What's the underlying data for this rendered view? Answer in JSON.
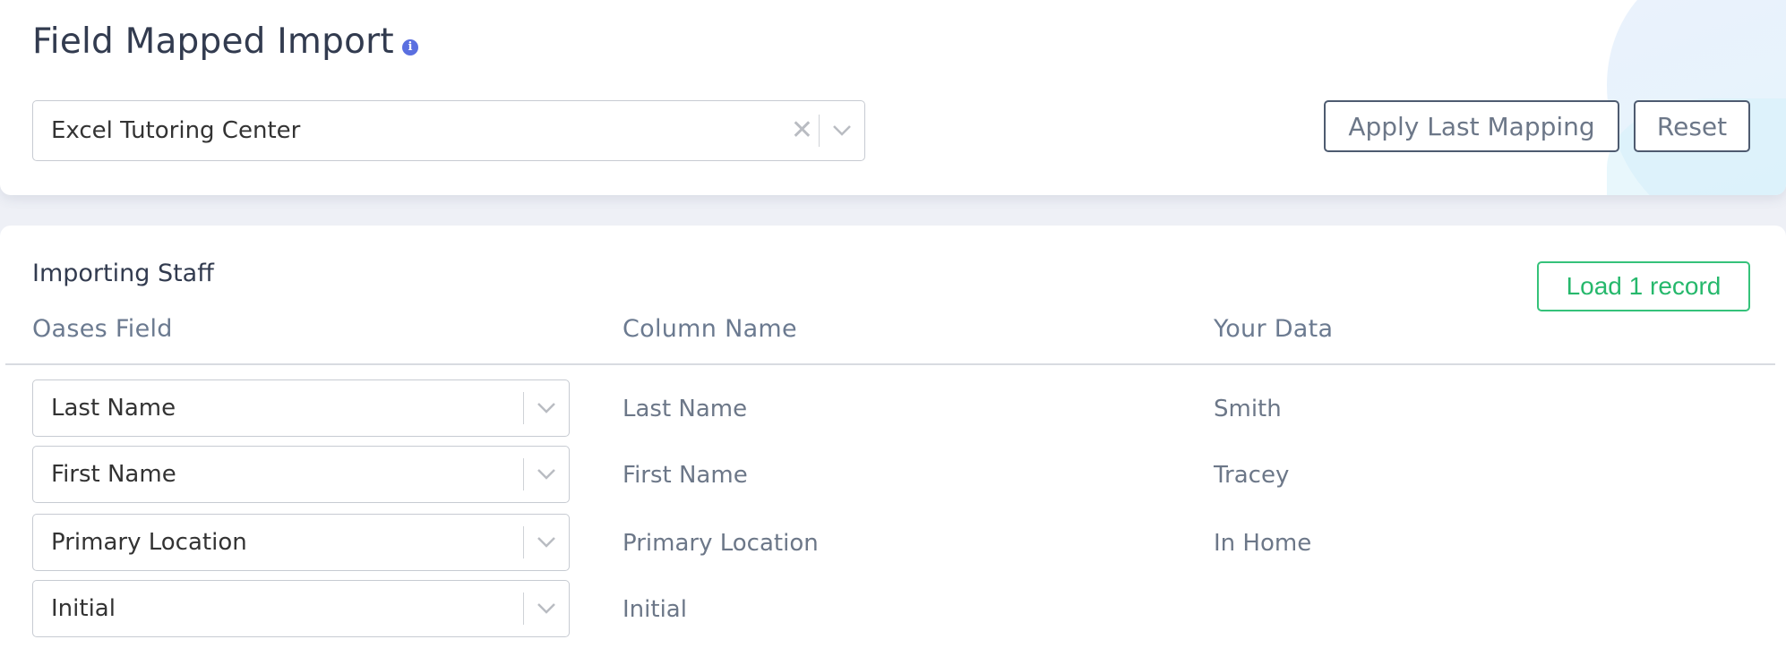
{
  "header": {
    "title": "Field Mapped Import",
    "info_icon": "info-icon",
    "company_select": {
      "value": "Excel Tutoring Center"
    },
    "apply_last_mapping_label": "Apply Last Mapping",
    "reset_label": "Reset"
  },
  "import": {
    "section_title": "Importing Staff",
    "load_button_label": "Load 1 record",
    "columns": [
      "Oases Field",
      "Column Name",
      "Your Data"
    ],
    "rows": [
      {
        "field": "Last Name",
        "column": "Last Name",
        "data": "Smith"
      },
      {
        "field": "First Name",
        "column": "First Name",
        "data": "Tracey"
      },
      {
        "field": "Primary Location",
        "column": "Primary Location",
        "data": "In Home"
      },
      {
        "field": "Initial",
        "column": "Initial",
        "data": ""
      }
    ]
  },
  "colors": {
    "accent_green": "#26b86c",
    "info_blue": "#5a6fe0",
    "button_border": "#4e5b70"
  }
}
